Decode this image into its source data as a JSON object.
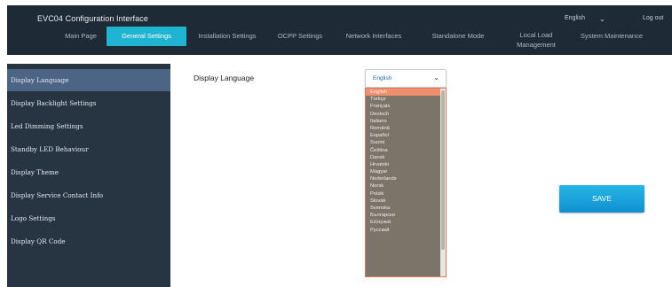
{
  "header": {
    "app_title": "EVC04 Configuration Interface",
    "language": "English",
    "language_chevron": "chevron-down-icon",
    "logout": "Log out"
  },
  "nav": {
    "tabs": [
      {
        "label": "Main Page"
      },
      {
        "label": "General Settings",
        "active": true
      },
      {
        "label": "Installation Settings"
      },
      {
        "label": "OCPP Settings"
      },
      {
        "label": "Network Interfaces"
      },
      {
        "label": "Standalone Mode"
      },
      {
        "label_line1": "Local Load",
        "label_line2": "Management"
      },
      {
        "label": "System Maintenance"
      }
    ]
  },
  "sidebar": {
    "items": [
      {
        "label": "Display Language",
        "active": true
      },
      {
        "label": "Display Backlight Settings"
      },
      {
        "label": "Led Dimming Settings"
      },
      {
        "label": "Standby LED Behaviour"
      },
      {
        "label": "Display Theme"
      },
      {
        "label": "Display Service Contact Info"
      },
      {
        "label": "Logo Settings"
      },
      {
        "label": "Display QR Code"
      }
    ]
  },
  "main": {
    "field_label": "Display Language",
    "select_value": "English",
    "options": [
      "English",
      "Türkçe",
      "Français",
      "Deutsch",
      "Italiano",
      "Română",
      "Español",
      "Suomi",
      "Čeština",
      "Dansk",
      "Hrvatski",
      "Magyar",
      "Nederlands",
      "Norsk",
      "Polski",
      "Slovák",
      "Svenska",
      "Български",
      "Ελληνικά",
      "Русский"
    ],
    "save_label": "SAVE"
  },
  "colors": {
    "topbar": "#1f2a37",
    "active_tab": "#1eb4d2",
    "sidebar": "#273442",
    "sidebar_active": "#4d6585",
    "dropdown_list": "#7a7469",
    "option_selected": "#f08f6e",
    "save_button": "#1aa3dc"
  }
}
